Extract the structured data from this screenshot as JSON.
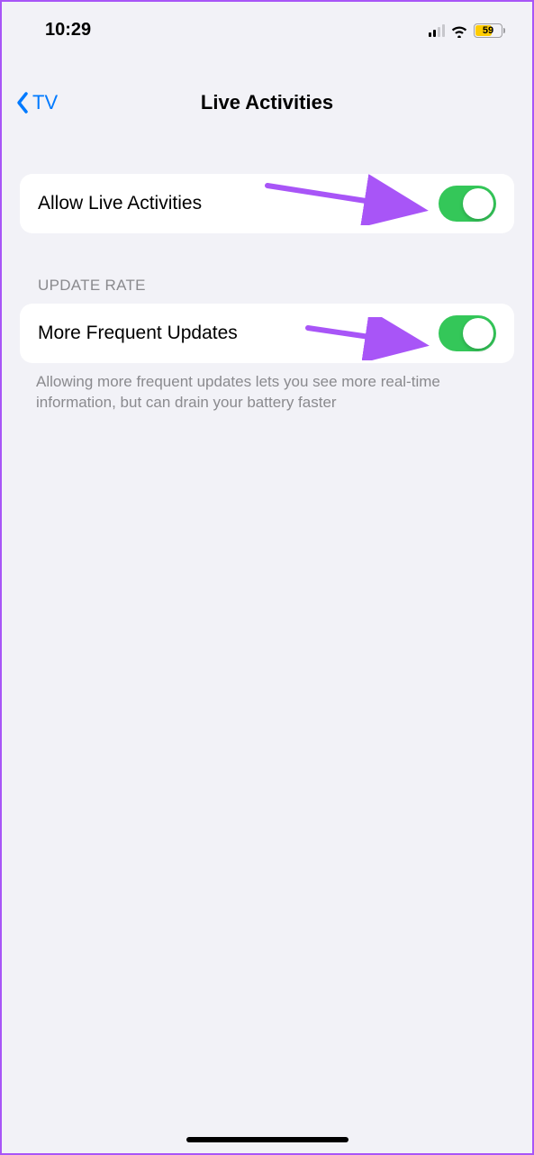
{
  "statusBar": {
    "time": "10:29",
    "batteryPercent": "59"
  },
  "nav": {
    "backLabel": "TV",
    "title": "Live Activities"
  },
  "sections": {
    "allowRow": {
      "label": "Allow Live Activities"
    },
    "updateRate": {
      "header": "UPDATE RATE",
      "rowLabel": "More Frequent Updates",
      "footer": "Allowing more frequent updates lets you see more real-time information, but can drain your battery faster"
    }
  },
  "colors": {
    "accentBlue": "#007aff",
    "toggleGreen": "#34c759",
    "batteryYellow": "#ffcc00",
    "annotationPurple": "#a855f7"
  }
}
